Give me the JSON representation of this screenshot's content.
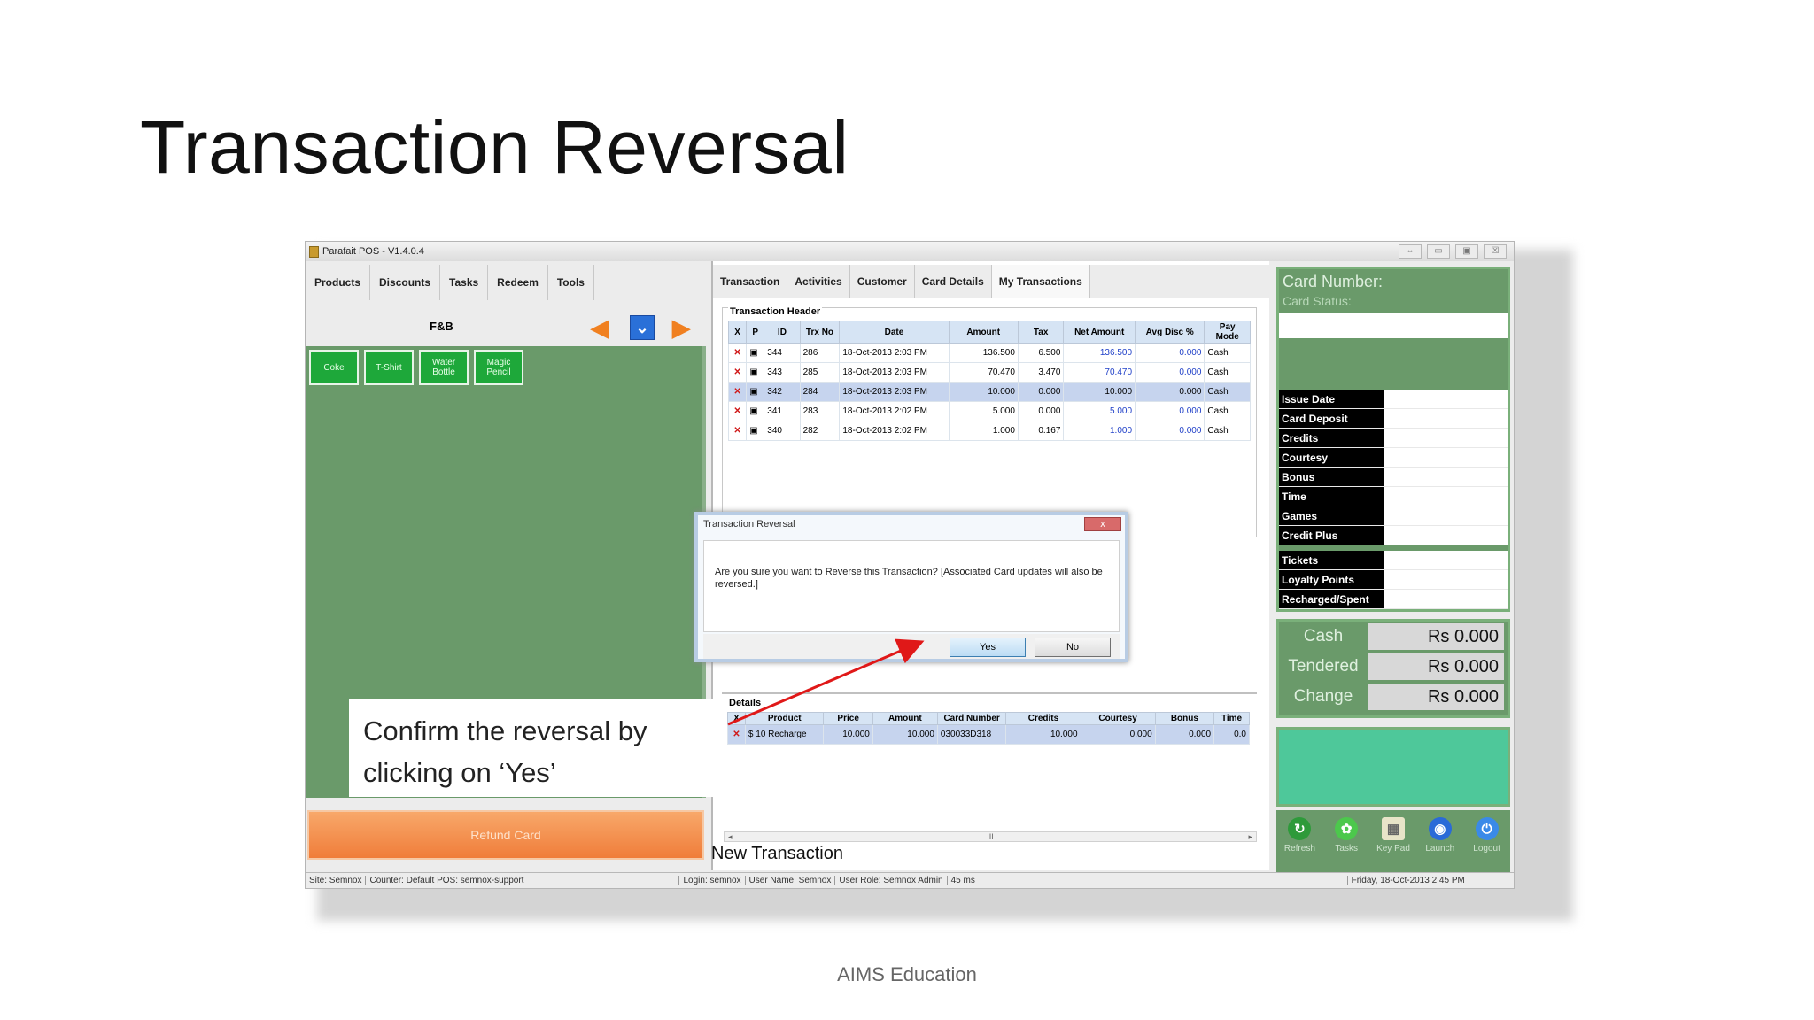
{
  "slide": {
    "title": "Transaction Reversal",
    "footer": "AIMS Education",
    "callout": "Confirm the reversal by clicking on ‘Yes’"
  },
  "window": {
    "title": "Parafait POS - V1.4.0.4",
    "controls": [
      "⇔",
      "▭",
      "▣",
      "☒"
    ]
  },
  "left_panel": {
    "tabs": [
      "Products",
      "Discounts",
      "Tasks",
      "Redeem",
      "Tools"
    ],
    "category": "F&B",
    "products": [
      "Coke",
      "T-Shirt",
      "Water Bottle",
      "Magic Pencil"
    ],
    "refund_button": "Refund Card"
  },
  "middle_panel": {
    "tabs": [
      "Transaction",
      "Activities",
      "Customer",
      "Card Details",
      "My Transactions"
    ],
    "header_group_label": "Transaction Header",
    "header_columns": [
      "X",
      "P",
      "ID",
      "Trx No",
      "Date",
      "Amount",
      "Tax",
      "Net Amount",
      "Avg Disc %",
      "Pay Mode"
    ],
    "header_rows": [
      {
        "id": "344",
        "trx": "286",
        "date": "18-Oct-2013 2:03 PM",
        "amount": "136.500",
        "tax": "6.500",
        "net": "136.500",
        "disc": "0.000",
        "pay": "Cash"
      },
      {
        "id": "343",
        "trx": "285",
        "date": "18-Oct-2013 2:03 PM",
        "amount": "70.470",
        "tax": "3.470",
        "net": "70.470",
        "disc": "0.000",
        "pay": "Cash"
      },
      {
        "id": "342",
        "trx": "284",
        "date": "18-Oct-2013 2:03 PM",
        "amount": "10.000",
        "tax": "0.000",
        "net": "10.000",
        "disc": "0.000",
        "pay": "Cash"
      },
      {
        "id": "341",
        "trx": "283",
        "date": "18-Oct-2013 2:02 PM",
        "amount": "5.000",
        "tax": "0.000",
        "net": "5.000",
        "disc": "0.000",
        "pay": "Cash"
      },
      {
        "id": "340",
        "trx": "282",
        "date": "18-Oct-2013 2:02 PM",
        "amount": "1.000",
        "tax": "0.167",
        "net": "1.000",
        "disc": "0.000",
        "pay": "Cash"
      }
    ],
    "details_group_label": "Details",
    "details_columns": [
      "X",
      "Product",
      "Price",
      "Amount",
      "Card Number",
      "Credits",
      "Courtesy",
      "Bonus",
      "Time"
    ],
    "details_rows": [
      {
        "product": "$ 10 Recharge",
        "price": "10.000",
        "amount": "10.000",
        "card": "030033D318",
        "credits": "10.000",
        "courtesy": "0.000",
        "bonus": "0.000",
        "time": "0.0"
      }
    ],
    "scroll_thumb": "III",
    "status_text": "New Transaction"
  },
  "dialog": {
    "title": "Transaction Reversal",
    "message": "Are you sure you want to Reverse this Transaction? [Associated Card updates will also be reversed.]",
    "yes": "Yes",
    "no": "No",
    "close": "x"
  },
  "right_panel": {
    "card_number_label": "Card Number:",
    "card_status_label": "Card Status:",
    "card_fields": [
      "Issue Date",
      "Card Deposit",
      "Credits",
      "Courtesy",
      "Bonus",
      "Time",
      "Games",
      "Credit Plus"
    ],
    "card_fields_2": [
      "Tickets",
      "Loyalty Points",
      "Recharged/Spent"
    ],
    "cash": [
      {
        "label": "Cash",
        "value": "Rs 0.000"
      },
      {
        "label": "Tendered",
        "value": "Rs 0.000"
      },
      {
        "label": "Change",
        "value": "Rs 0.000"
      }
    ],
    "icons": [
      {
        "label": "Refresh",
        "icon": "refresh-icon",
        "color": "#2e9a3a"
      },
      {
        "label": "Tasks",
        "icon": "tasks-icon",
        "color": "#4cc84c"
      },
      {
        "label": "Key Pad",
        "icon": "keypad-icon",
        "color": "#e8e4c8"
      },
      {
        "label": "Launch",
        "icon": "launch-icon",
        "color": "#2a6ad8"
      },
      {
        "label": "Logout",
        "icon": "logout-icon",
        "color": "#3a8ae8"
      }
    ]
  },
  "status_bar": {
    "site": "Site: Semnox",
    "counter": "Counter: Default POS: semnox-support",
    "login": "Login: semnox",
    "user_name": "User Name: Semnox",
    "user_role": "User Role: Semnox Admin",
    "ms": "45 ms",
    "datetime": "Friday, 18-Oct-2013 2:45 PM"
  },
  "colors": {
    "panel_green": "#6a9a6a",
    "product_green": "#1ea83a",
    "refund_orange": "#f07d3a",
    "arrow_red": "#e01818"
  }
}
